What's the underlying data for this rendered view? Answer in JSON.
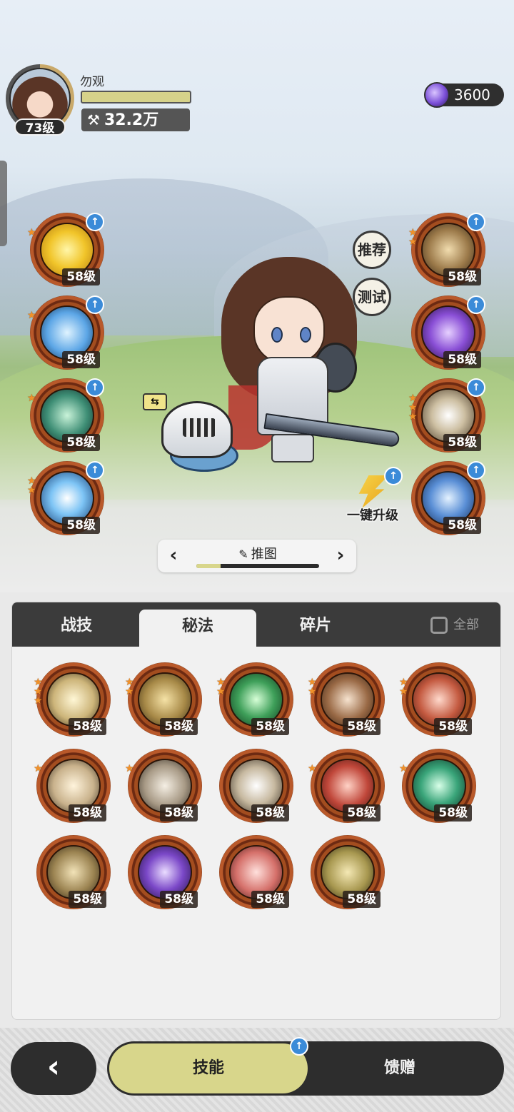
{
  "header": {
    "player_name": "勿观",
    "player_level": "73级",
    "power": "32.2万",
    "currency": "3600"
  },
  "scene_buttons": {
    "recommend": "推荐",
    "test": "测试",
    "upgrade_all": "一键升级"
  },
  "equipped_skills": {
    "left": [
      {
        "level": "58级",
        "icon": "golden-crown-burst-icon",
        "stars": 1
      },
      {
        "level": "58级",
        "icon": "blue-ice-ring-icon",
        "stars": 1
      },
      {
        "level": "58级",
        "icon": "green-web-icon",
        "stars": 1
      },
      {
        "level": "58级",
        "icon": "ice-crystal-icon",
        "stars": 2
      }
    ],
    "right": [
      {
        "level": "58级",
        "icon": "golden-fist-icon",
        "stars": 2
      },
      {
        "level": "58级",
        "icon": "purple-beast-icon",
        "stars": 0
      },
      {
        "level": "58级",
        "icon": "crescent-slash-icon",
        "stars": 3
      },
      {
        "level": "58级",
        "icon": "blue-shield-swirl-icon",
        "stars": 0
      }
    ]
  },
  "stage_selector": {
    "label": "推图",
    "progress": 0.2
  },
  "tabs": {
    "combat": "战技",
    "secret": "秘法",
    "fragments": "碎片",
    "all": "全部",
    "active": "secret"
  },
  "secret_skills": [
    {
      "level": "58级",
      "icon": "eye-icon",
      "stars": 3
    },
    {
      "level": "58级",
      "icon": "golden-armor-icon",
      "stars": 2
    },
    {
      "level": "58级",
      "icon": "heart-heal-icon",
      "stars": 2
    },
    {
      "level": "58级",
      "icon": "heart-shield-icon",
      "stars": 2
    },
    {
      "level": "58级",
      "icon": "broken-shield-icon",
      "stars": 2
    },
    {
      "level": "58级",
      "icon": "sword-up-icon",
      "stars": 1
    },
    {
      "level": "58级",
      "icon": "sword-boost-icon",
      "stars": 1
    },
    {
      "level": "58级",
      "icon": "blade-strike-icon",
      "stars": 0
    },
    {
      "level": "58级",
      "icon": "red-burst-icon",
      "stars": 1
    },
    {
      "level": "58级",
      "icon": "jade-sword-icon",
      "stars": 1
    },
    {
      "level": "58级",
      "icon": "golden-claw-icon",
      "stars": 0
    },
    {
      "level": "58级",
      "icon": "purple-beast-rush-icon",
      "stars": 0
    },
    {
      "level": "58级",
      "icon": "red-sword-icon",
      "stars": 0
    },
    {
      "level": "58级",
      "icon": "golden-golem-icon",
      "stars": 0
    }
  ],
  "bottom_nav": {
    "skills": "技能",
    "gifts": "馈赠"
  },
  "colors": {
    "accent": "#d8d68b",
    "dark": "#2d2d2d",
    "upgrade_badge": "#3b8bd8",
    "star": "#f0912a"
  }
}
